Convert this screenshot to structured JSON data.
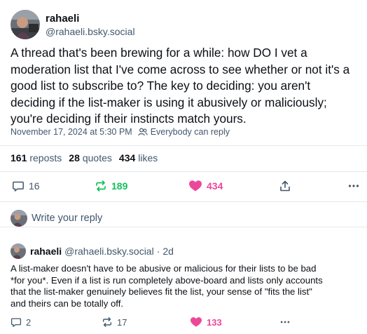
{
  "post": {
    "display_name": "rahaeli",
    "handle": "@rahaeli.bsky.social",
    "avatar_icon": "avatar-photo",
    "lines": [
      "A thread that's been brewing for a while: how DO I vet a",
      "moderation list that I've come across to see whether or not it's a",
      "good list to subscribe to? The key to deciding: you aren't",
      "deciding if the list-maker is using it abusively or maliciously;",
      "you're deciding if their instincts match yours."
    ],
    "timestamp": "November 17, 2024 at 5:30 PM",
    "audience_icon": "people-icon",
    "audience": "Everybody can reply"
  },
  "stats": {
    "reposts_count": "161",
    "reposts_label": "reposts",
    "quotes_count": "28",
    "quotes_label": "quotes",
    "likes_count": "434",
    "likes_label": "likes"
  },
  "actions": {
    "replies": "16",
    "reposts": "189",
    "likes": "434",
    "reply_icon": "comment-icon",
    "repost_icon": "repost-icon",
    "like_icon": "heart-icon",
    "share_icon": "share-icon",
    "more_icon": "more-icon"
  },
  "composer": {
    "placeholder": "Write your reply"
  },
  "reply": {
    "display_name": "rahaeli",
    "handle": "@rahaeli.bsky.social",
    "separator": "·",
    "age": "2d",
    "lines": [
      "A list-maker doesn't have to be abusive or malicious for their lists to be bad",
      "*for you*. Even if a list is run completely above-board and lists only accounts",
      "that the list-maker genuinely believes fit the list, your sense of \"fits the list\"",
      "and theirs can be totally off."
    ],
    "replies": "2",
    "reposts": "17",
    "likes": "133"
  },
  "colors": {
    "text": "#0b0f14",
    "muted": "#42576c",
    "repost_green": "#13c05a",
    "like_pink": "#ec4899",
    "divider": "#e4e8ec"
  }
}
